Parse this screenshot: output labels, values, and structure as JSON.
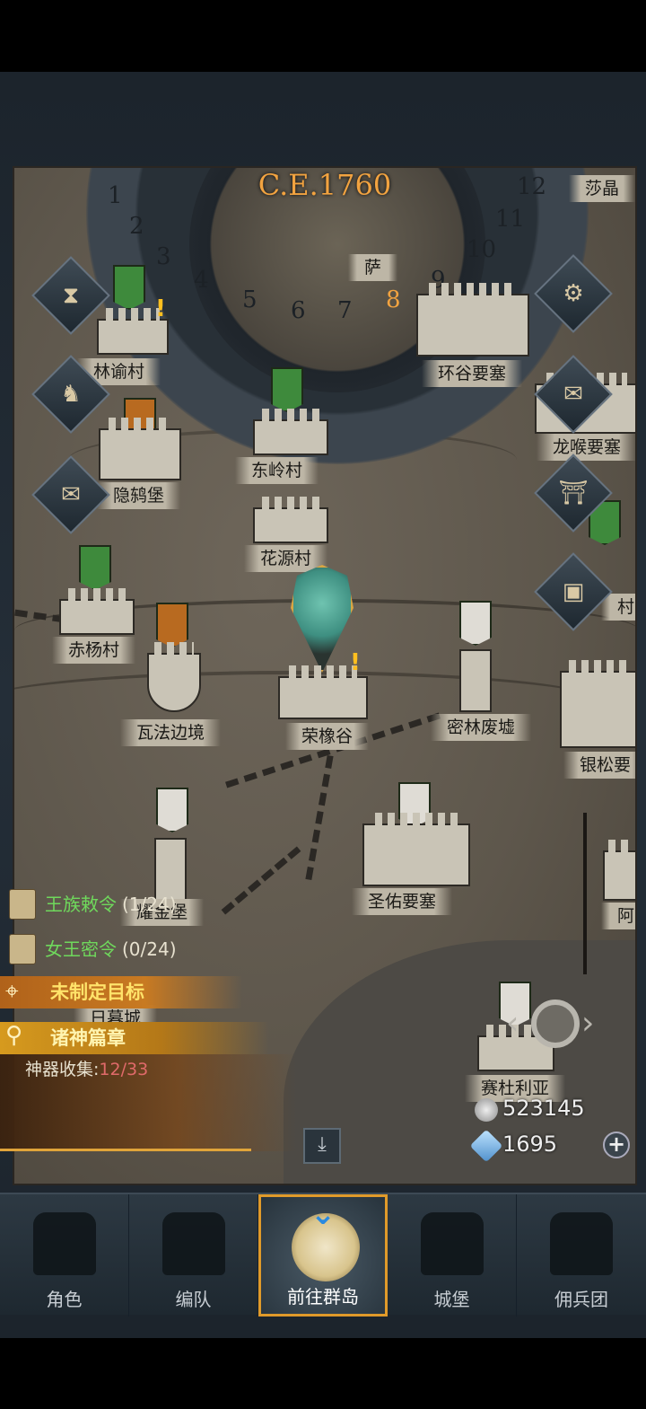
{
  "era": "C.E.1760",
  "months": [
    "1",
    "2",
    "3",
    "4",
    "5",
    "6",
    "7",
    "8",
    "9",
    "10",
    "11",
    "12"
  ],
  "current_month": "8",
  "locations": {
    "linyu": "林谕村",
    "huangu": "环谷要塞",
    "yinhe": "隐鸫堡",
    "dongling": "东岭村",
    "longhou": "龙喉要塞",
    "huayuan": "花源村",
    "chiyang": "赤杨村",
    "wafa": "瓦法边境",
    "rongxiang": "荣橡谷",
    "milin": "密林废墟",
    "yinsong": "银松要",
    "shengyou": "圣佑要塞",
    "saidu": "赛杜利亚",
    "sadu_partial": "萨",
    "shaji_partial": "莎晶",
    "jiaojin_partial": "耀金堡",
    "rimu_partial": "日暮城",
    "edge_cun": "村",
    "edge_a": "阿"
  },
  "quests": [
    {
      "name": "王族敕令",
      "count": "(1/24)"
    },
    {
      "name": "女王密令",
      "count": "(0/24)"
    }
  ],
  "goal": "未制定目标",
  "search": "诸神篇章",
  "artifact": {
    "label": "神器收集:",
    "value": "12/33"
  },
  "resources": {
    "silver": "523145",
    "crystal": "1695"
  },
  "tabs": [
    "角色",
    "编队",
    "前往群岛",
    "城堡",
    "佣兵团"
  ],
  "icons": {
    "hourglass": "hourglass-icon",
    "bag": "money-bag-icon",
    "scroll": "scroll-icon",
    "gear": "gear-icon",
    "mail": "mail-icon",
    "gate": "gate-icon",
    "cart": "supplies-icon"
  }
}
